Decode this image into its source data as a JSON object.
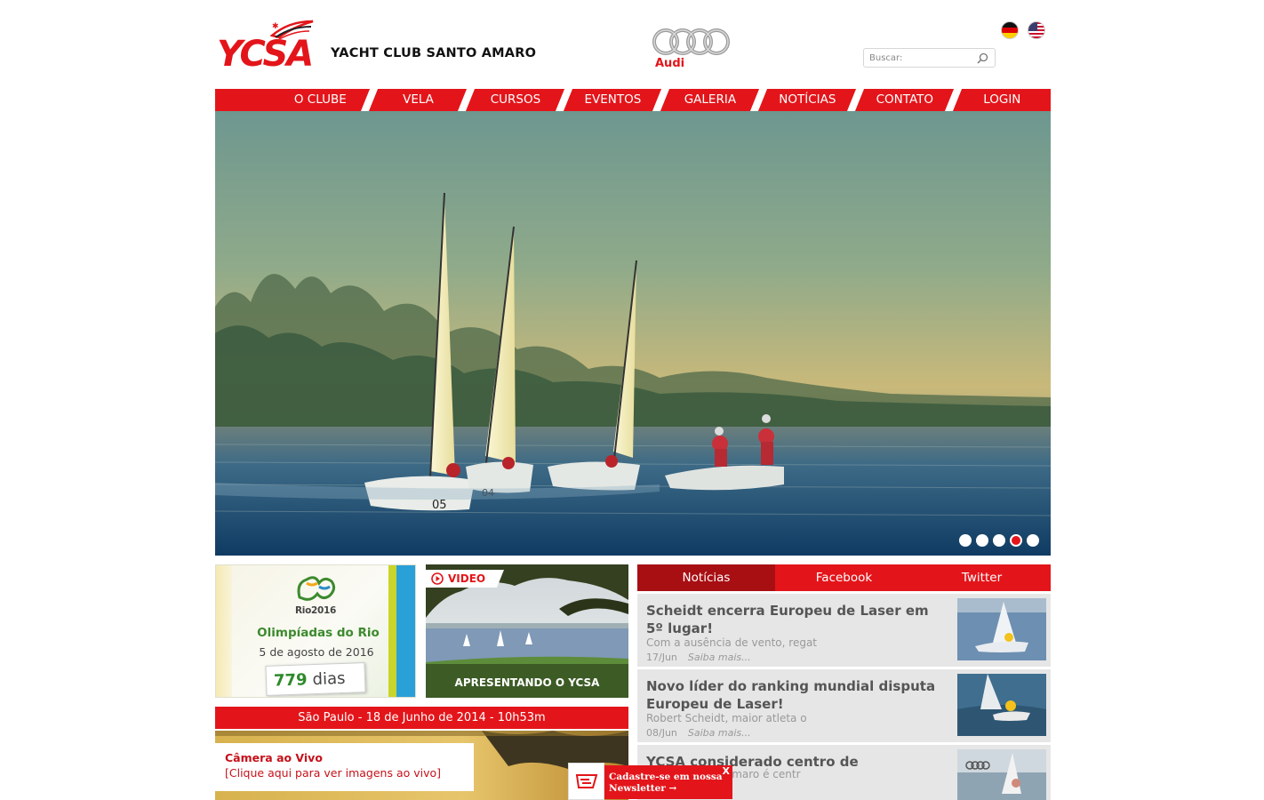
{
  "header": {
    "logo_abbr": "YCSA",
    "logo_name": "YACHT CLUB SANTO AMARO",
    "sponsor_name": "Audi",
    "search_placeholder": "Buscar:",
    "flags": [
      "german-flag-icon",
      "us-flag-icon"
    ]
  },
  "nav": {
    "items": [
      {
        "label": "O CLUBE"
      },
      {
        "label": "VELA"
      },
      {
        "label": "CURSOS"
      },
      {
        "label": "EVENTOS"
      },
      {
        "label": "GALERIA"
      },
      {
        "label": "NOTÍCIAS"
      },
      {
        "label": "CONTATO"
      },
      {
        "label": "LOGIN"
      }
    ]
  },
  "hero": {
    "slide_count": 5,
    "active_slide": 4,
    "sail_numbers": [
      "05",
      "04"
    ]
  },
  "rio": {
    "logo_text": "Rio2016",
    "title": "Olimpíadas do Rio",
    "date": "5 de agosto de 2016",
    "days_count": "779",
    "days_unit": "dias"
  },
  "video": {
    "tag": "VIDEO",
    "caption": "APRESENTANDO O YCSA"
  },
  "datebar": {
    "text": "São Paulo - 18 de Junho de 2014 - 10h53m"
  },
  "camera": {
    "title": "Câmera ao Vivo",
    "subtitle": "[Clique aqui para ver imagens ao vivo]"
  },
  "tabs": {
    "items": [
      {
        "label": "Notícias",
        "active": true
      },
      {
        "label": "Facebook",
        "active": false
      },
      {
        "label": "Twitter",
        "active": false
      }
    ]
  },
  "news": [
    {
      "title": "Scheidt encerra Europeu de Laser em 5º lugar!",
      "excerpt": "Com a ausência de vento, regat",
      "date": "17/Jun",
      "more": "Saiba mais..."
    },
    {
      "title": "Novo líder do ranking mundial disputa Europeu de Laser!",
      "excerpt": "Robert Scheidt, maior atleta o",
      "date": "08/Jun",
      "more": "Saiba mais..."
    },
    {
      "title": "YCSA considerado centro de excelência!",
      "excerpt": "Amaro é centr",
      "date": "",
      "more": ""
    }
  ],
  "newsletter": {
    "line1": "Cadastre-se em nossa",
    "line2": "Newsletter →",
    "close": "X"
  },
  "colors": {
    "brand_red": "#e3151a",
    "dark_red": "#a80f13",
    "news_bg": "#e6e6e6",
    "rio_green": "#3c8a2e"
  }
}
